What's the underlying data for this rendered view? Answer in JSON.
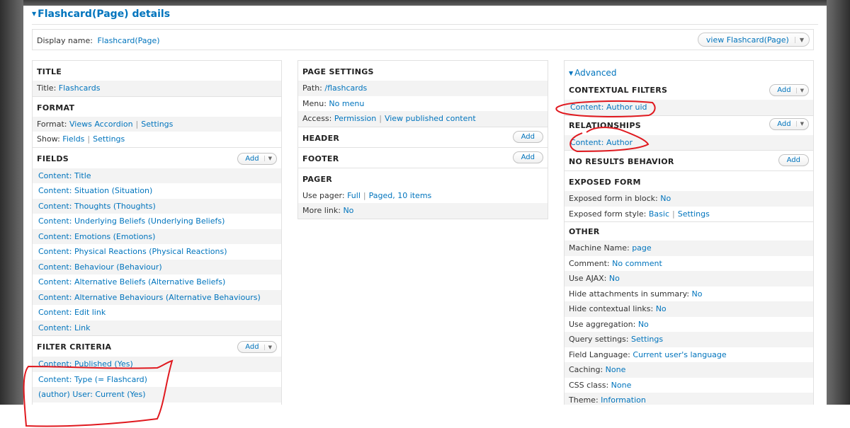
{
  "section_title": "Flashcard(Page) details",
  "display": {
    "label": "Display name:",
    "value": "Flashcard(Page)",
    "view_button": "view Flashcard(Page)"
  },
  "add_label": "Add",
  "col1": {
    "title_head": "TITLE",
    "title_label": "Title:",
    "title_value": "Flashcards",
    "format_head": "FORMAT",
    "format_label": "Format:",
    "format_value": "Views Accordion",
    "format_settings": "Settings",
    "show_label": "Show:",
    "show_value": "Fields",
    "show_settings": "Settings",
    "fields_head": "FIELDS",
    "fields": [
      "Content: Title",
      "Content: Situation (Situation)",
      "Content: Thoughts (Thoughts)",
      "Content: Underlying Beliefs (Underlying Beliefs)",
      "Content: Emotions (Emotions)",
      "Content: Physical Reactions (Physical Reactions)",
      "Content: Behaviour (Behaviour)",
      "Content: Alternative Beliefs (Alternative Beliefs)",
      "Content: Alternative Behaviours (Alternative Behaviours)",
      "Content: Edit link",
      "Content: Link"
    ],
    "filter_head": "FILTER CRITERIA",
    "filters": [
      "Content: Published (Yes)",
      "Content: Type (= Flashcard)",
      "(author) User: Current (Yes)"
    ]
  },
  "col2": {
    "page_head": "PAGE SETTINGS",
    "path_label": "Path:",
    "path_value": "/flashcards",
    "menu_label": "Menu:",
    "menu_value": "No menu",
    "access_label": "Access:",
    "access_value": "Permission",
    "access_value2": "View published content",
    "header_head": "HEADER",
    "footer_head": "FOOTER",
    "pager_head": "PAGER",
    "pager_label": "Use pager:",
    "pager_value": "Full",
    "pager_value2": "Paged, 10 items",
    "more_label": "More link:",
    "more_value": "No"
  },
  "col3": {
    "advanced": "Advanced",
    "ctx_head": "CONTEXTUAL FILTERS",
    "ctx_item": "Content: Author uid",
    "rel_head": "RELATIONSHIPS",
    "rel_item": "Content: Author",
    "noresults_head": "NO RESULTS BEHAVIOR",
    "exposed_head": "EXPOSED FORM",
    "exposed_block_label": "Exposed form in block:",
    "exposed_block_value": "No",
    "exposed_style_label": "Exposed form style:",
    "exposed_style_value": "Basic",
    "exposed_style_settings": "Settings",
    "other_head": "OTHER",
    "other": [
      {
        "label": "Machine Name:",
        "value": "page"
      },
      {
        "label": "Comment:",
        "value": "No comment"
      },
      {
        "label": "Use AJAX:",
        "value": "No"
      },
      {
        "label": "Hide attachments in summary:",
        "value": "No"
      },
      {
        "label": "Hide contextual links:",
        "value": "No"
      },
      {
        "label": "Use aggregation:",
        "value": "No"
      },
      {
        "label": "Query settings:",
        "value": "Settings"
      },
      {
        "label": "Field Language:",
        "value": "Current user's language"
      },
      {
        "label": "Caching:",
        "value": "None"
      },
      {
        "label": "CSS class:",
        "value": "None"
      },
      {
        "label": "Theme:",
        "value": "Information"
      }
    ]
  },
  "colors": {
    "link": "#0074bd",
    "annotation": "#e0191f"
  }
}
